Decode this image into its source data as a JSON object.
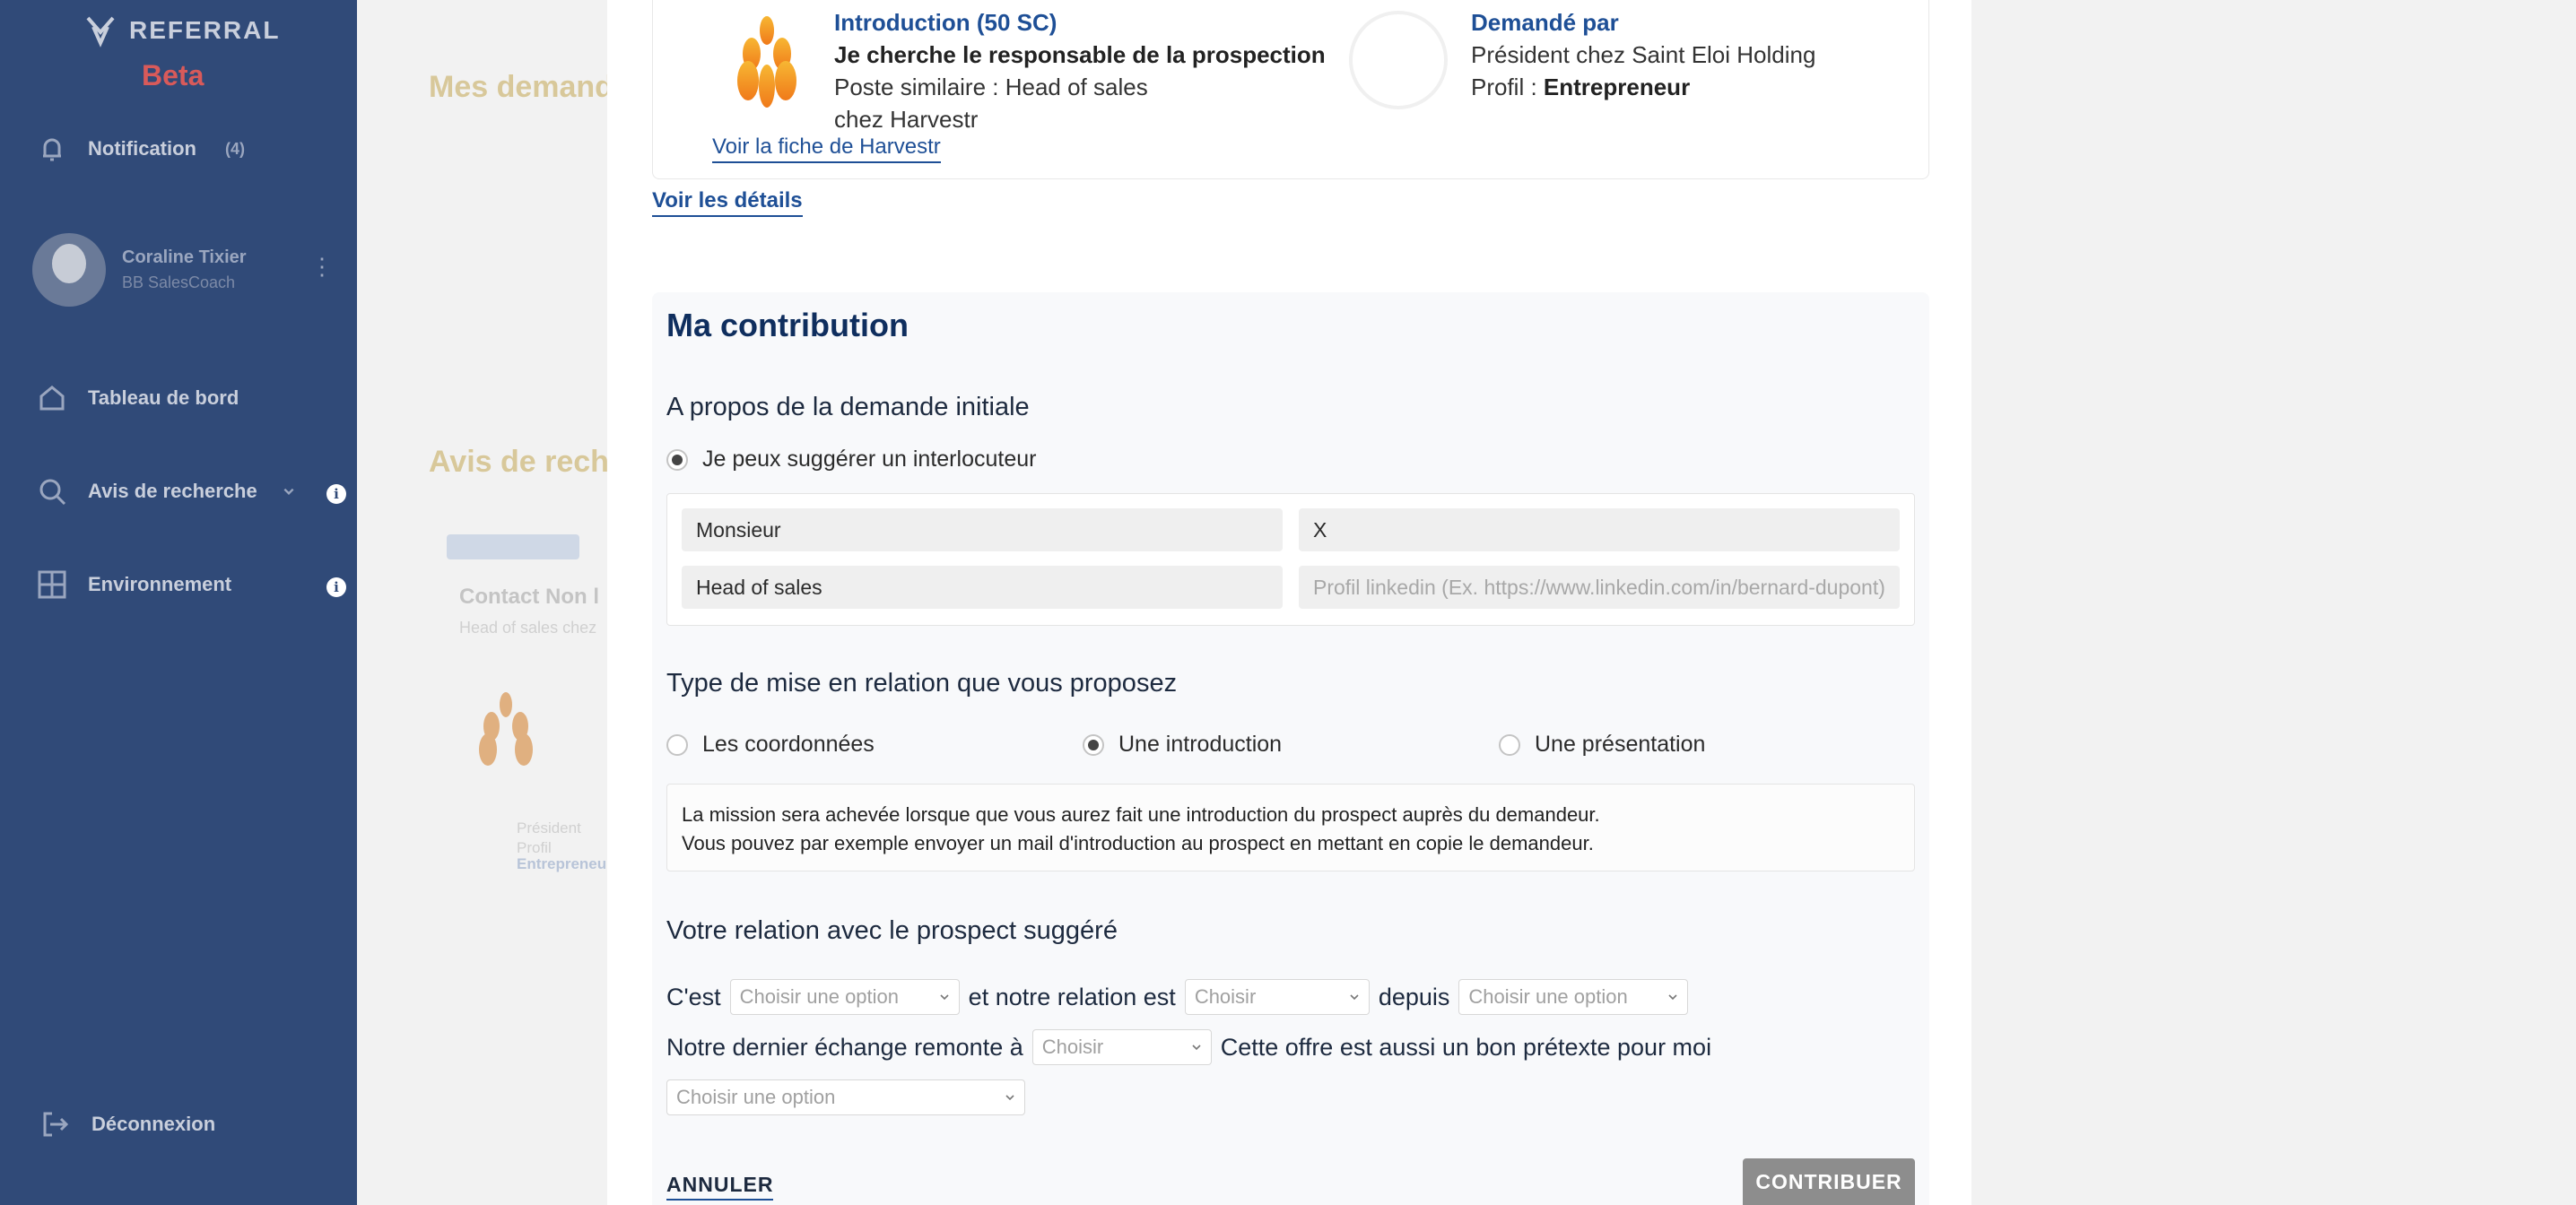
{
  "sidebar": {
    "logo_text": "REFERRAL",
    "beta_label": "Beta",
    "notifications_label": "Notification",
    "notifications_count": "(4)",
    "user_name": "Coraline Tixier",
    "user_company": "BB SalesCoach",
    "items": [
      {
        "label": "Tableau de bord"
      },
      {
        "label": "Avis de recherche"
      },
      {
        "label": "Environnement"
      }
    ],
    "logout_label": "Déconnexion"
  },
  "background": {
    "heading_1": "Mes demandes",
    "heading_2": "Avis de recherche",
    "card_title": "Contact Non l",
    "card_sub": "Head of sales chez",
    "card_role": "Président",
    "card_profil": "Profil",
    "card_profil_value": "Entrepreneur"
  },
  "top_card": {
    "intro_title": "Introduction (50 SC)",
    "headline": "Je cherche le responsable de la prospection",
    "poste": "Poste similaire : Head of sales",
    "company": "chez Harvestr",
    "link_fiche": "Voir la fiche de Harvestr",
    "requested_by_title": "Demandé par",
    "requester_role": "Président chez Saint Eloi Holding",
    "profil_label": "Profil : ",
    "profil_value": "Entrepreneur"
  },
  "link_details": "Voir les détails",
  "contribution": {
    "title": "Ma contribution",
    "section_initial": "A propos de la demande initiale",
    "suggest_option": "Je peux suggérer un interlocuteur",
    "fields": {
      "civility": "Monsieur",
      "name": "X",
      "job": "Head of sales",
      "linkedin_placeholder": "Profil linkedin (Ex. https://www.linkedin.com/in/bernard-dupont)"
    },
    "section_type": "Type de mise en relation que vous proposez",
    "type_options": [
      {
        "label": "Les coordonnées"
      },
      {
        "label": "Une introduction"
      },
      {
        "label": "Une présentation"
      }
    ],
    "selected_type": "Une introduction",
    "info_line_1": "La mission sera achevée lorsque que  vous aurez fait une introduction du prospect auprès du demandeur.",
    "info_line_2": "Vous pouvez par exemple envoyer un mail d'introduction au prospect en mettant en copie le demandeur.",
    "section_relation": "Votre relation avec le prospect suggéré",
    "row1": {
      "prefix": "C'est",
      "select1": "Choisir une option",
      "mid": "et notre relation est",
      "select2": "Choisir",
      "mid2": "depuis",
      "select3": "Choisir une option"
    },
    "row2": {
      "prefix": "Notre dernier échange remonte à",
      "select1": "Choisir",
      "suffix": "Cette offre est aussi un bon prétexte pour moi"
    },
    "row3_select": "Choisir une option",
    "cancel_label": "ANNULER",
    "submit_label": "CONTRIBUER"
  }
}
